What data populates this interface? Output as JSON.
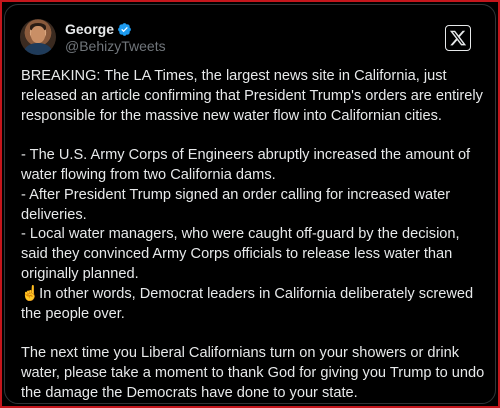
{
  "author": {
    "display_name": "George",
    "handle": "@BehizyTweets",
    "verified": true,
    "avatar": "profile-photo"
  },
  "brand": {
    "icon": "x-logo-icon"
  },
  "post": {
    "intro": "BREAKING: The LA Times, the largest news site in California, just released an article confirming that President Trump's orders are entirely responsible for the massive new water flow into Californian cities.",
    "point_1": "- The U.S. Army Corps of Engineers abruptly increased the amount of water flowing from two California dams.",
    "point_2": "- After President Trump signed an order calling for increased water deliveries.",
    "point_3": "- Local water managers, who were caught off-guard by the decision, said they convinced Army Corps officials to release less water than originally planned.",
    "point_4": "☝️In other words, Democrat leaders in California deliberately screwed the people over.",
    "closing": "The next time you Liberal Californians turn on your showers or drink water, please take a moment to thank God for giving you Trump to undo the damage the Democrats have done to your state."
  },
  "colors": {
    "background": "#000000",
    "text": "#e7e9ea",
    "muted": "#71767b",
    "verified_badge": "#1d9bf0",
    "frame_border": "#c4161c"
  }
}
